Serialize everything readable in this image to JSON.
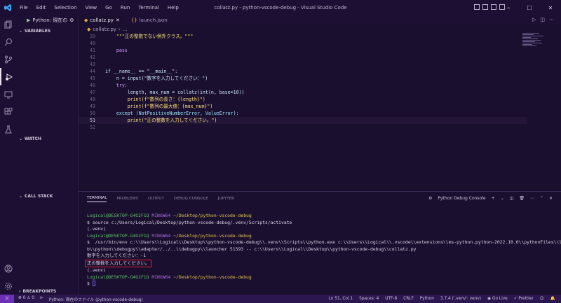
{
  "titlebar": {
    "menu": [
      "File",
      "Edit",
      "Selection",
      "View",
      "Go",
      "Run",
      "Terminal",
      "Help"
    ],
    "window_title": "collatz.py - python-vscode-debug - Visual Studio Code"
  },
  "sidebar": {
    "run_config": "Python: 現在の",
    "sections": {
      "variables": "VARIABLES",
      "watch": "WATCH",
      "call_stack": "CALL STACK",
      "breakpoints": "BREAKPOINTS"
    }
  },
  "tabs": [
    {
      "label": "collatz.py",
      "icon": "python-file-icon"
    },
    {
      "label": "launch.json",
      "icon": "json-file-icon"
    }
  ],
  "breadcrumb": {
    "file": "collatz.py",
    "symbol": "..."
  },
  "editor": {
    "current_line": 51,
    "lines": [
      {
        "n": "39",
        "code": "    \"\"\"正の整数でない例外クラス。\"\"\""
      },
      {
        "n": "40",
        "code": ""
      },
      {
        "n": "41",
        "code": "    pass"
      },
      {
        "n": "42",
        "code": ""
      },
      {
        "n": "43",
        "code": ""
      },
      {
        "n": "44",
        "code": "if __name__ == \"__main__\":"
      },
      {
        "n": "45",
        "code": "    n = input(\"数字を入力してください：\")"
      },
      {
        "n": "46",
        "code": "    try:"
      },
      {
        "n": "47",
        "code": "        length, max_num = collatz(int(n, base=10))"
      },
      {
        "n": "48",
        "code": "        print(f\"数列の長さ：{length}\")"
      },
      {
        "n": "49",
        "code": "        print(f\"数列の最大値：{max_num}\")"
      },
      {
        "n": "50",
        "code": "    except (NotPositiveNumberError, ValueError):"
      },
      {
        "n": "51",
        "code": "        print(\"正の整数を入力してください。\")"
      },
      {
        "n": "52",
        "code": ""
      }
    ]
  },
  "panel": {
    "tabs": [
      "TERMINAL",
      "PROBLEMS",
      "OUTPUT",
      "DEBUG CONSOLE",
      "JUPYTER"
    ],
    "active_tab": "TERMINAL",
    "terminal_selector": "Python Debug Console",
    "terminal": {
      "prompt_user": "Logical@DESKTOP-G4G2F1Q",
      "prompt_host": "MINGW64",
      "prompt_path": "~/Desktop/python-vscode-debug",
      "cmd1": "$ source c:/Users/Logical/Desktop/python-vscode-debug/.venv/Scripts/activate",
      "venv1": "(.venv)",
      "cmd2": "$  /usr/bin/env c:\\\\Users\\\\Logical\\\\Desktop\\\\python-vscode-debug\\\\.venv\\\\Scripts\\\\python.exe c:\\\\Users\\\\Logical\\\\.vscode\\\\extensions\\\\ms-python.python-2022.10.0\\\\pythonFiles\\\\li",
      "cmd2b": "b\\\\python\\\\debugpy\\\\adapter/../..\\\\debugpy\\\\launcher 51593 -- c:\\\\Users\\\\Logical\\\\Desktop\\\\python-vscode-debug\\\\collatz.py",
      "prompt_in": "数字を入力してください：-1",
      "output": "正の整数を入力してください。",
      "venv2": "(.venv)",
      "last_prompt": "$ "
    }
  },
  "status": {
    "errors": "0",
    "warnings": "0",
    "run": "Python: 現在のファイル (python-vscode-debug)",
    "position": "Ln 51, Col 1",
    "spaces": "Spaces: 4",
    "encoding": "UTF-8",
    "eol": "CRLF",
    "language": "Python",
    "interpreter": "3.7.4 ('.venv': venv)",
    "golive": "Go Live",
    "prettier": "Prettier"
  },
  "colors": {
    "accent": "#6b2fb8",
    "highlight_box": "#e2212d"
  }
}
